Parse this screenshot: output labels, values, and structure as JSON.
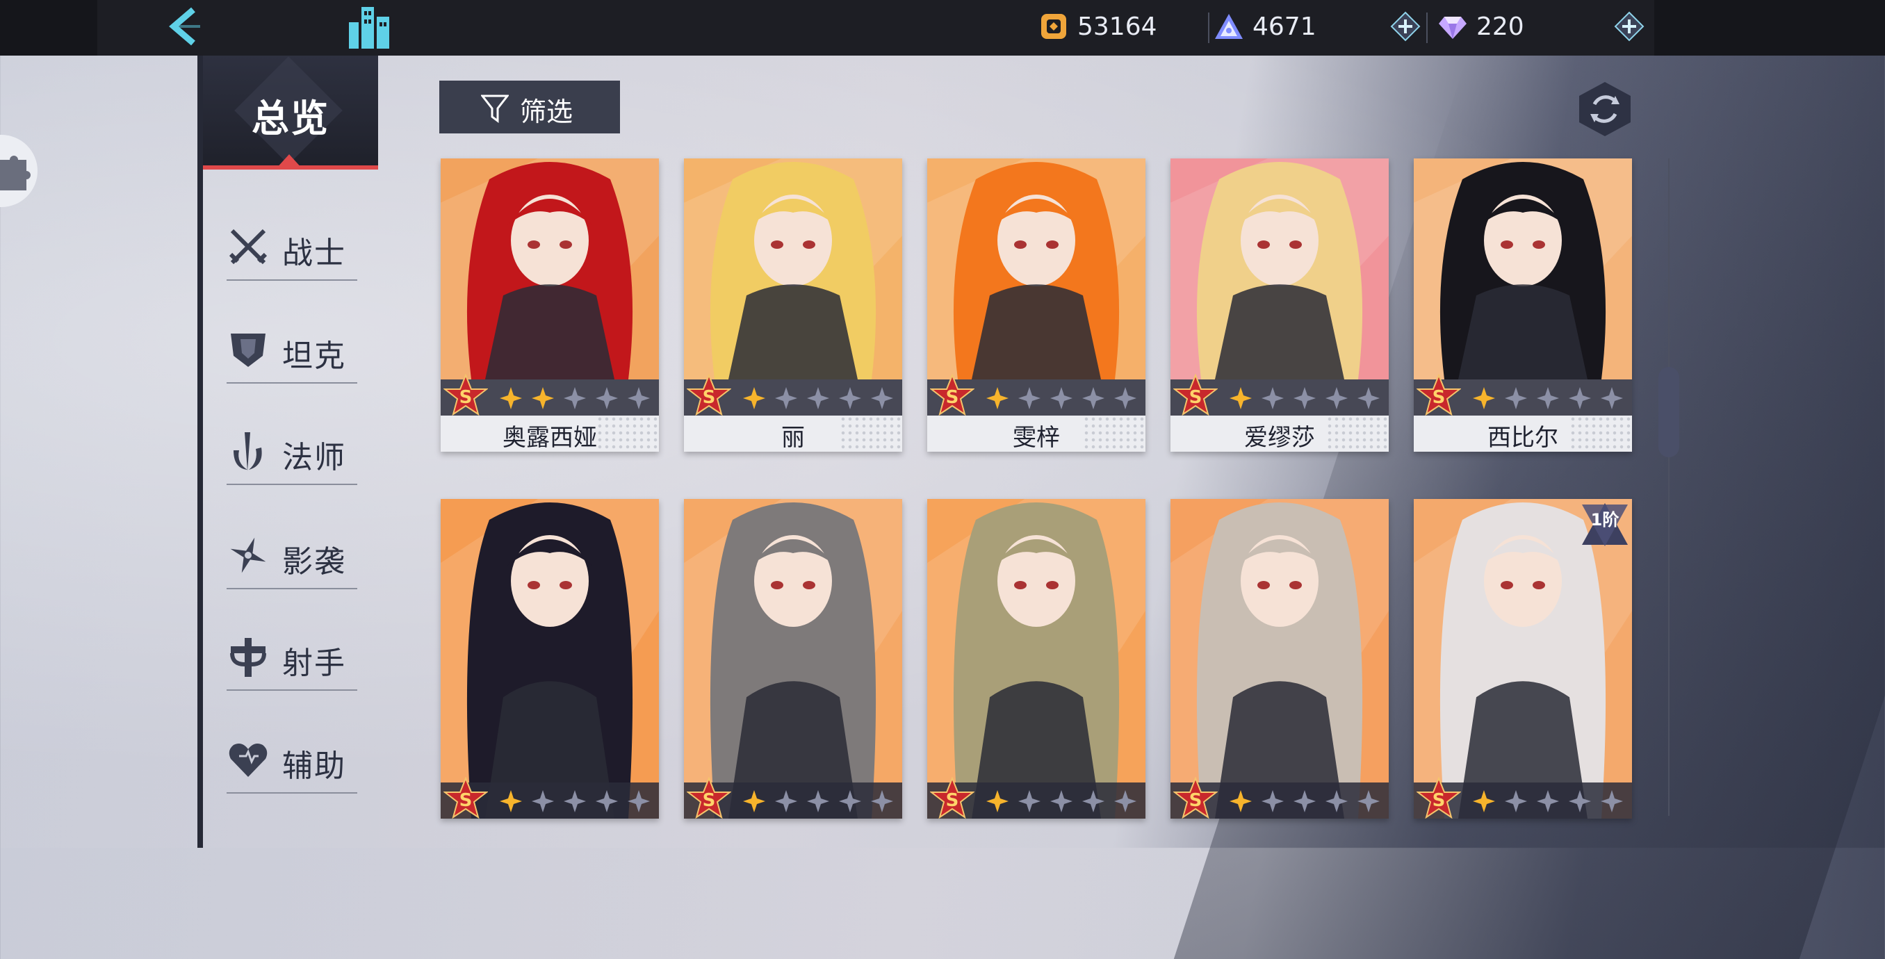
{
  "topbar": {
    "back_icon": "back-chevron-icon",
    "city_icon": "city-building-icon",
    "resources": [
      {
        "icon": "gold-coin-icon",
        "value": "53164",
        "color": "#f0a53a"
      },
      {
        "icon": "stamina-triangle-icon",
        "value": "4671",
        "color": "#7f8cff"
      },
      {
        "icon": "diamond-gem-icon",
        "value": "220",
        "color": "#c6a8ff"
      }
    ]
  },
  "sidebar": {
    "overview_label": "总览",
    "categories": [
      {
        "label": "战士",
        "icon": "crossed-swords-icon"
      },
      {
        "label": "坦克",
        "icon": "shield-icon"
      },
      {
        "label": "法师",
        "icon": "mage-staff-icon"
      },
      {
        "label": "影袭",
        "icon": "shuriken-icon"
      },
      {
        "label": "射手",
        "icon": "crosshair-icon"
      },
      {
        "label": "辅助",
        "icon": "heart-icon"
      }
    ]
  },
  "filter": {
    "label": "筛选",
    "icon": "funnel-icon"
  },
  "sync_icon": "refresh-cycle-icon",
  "characters": [
    {
      "name": "奥露西娅",
      "rank": "S",
      "stars": 2,
      "hair": "#c2171b",
      "bg": "#f2a35e"
    },
    {
      "name": "丽",
      "rank": "S",
      "stars": 1,
      "hair": "#f1cc63",
      "bg": "#f4b36a"
    },
    {
      "name": "雯梓",
      "rank": "S",
      "stars": 1,
      "hair": "#f3771d",
      "bg": "#f5b06a"
    },
    {
      "name": "爱缪莎",
      "rank": "S",
      "stars": 1,
      "hair": "#f0d08a",
      "bg": "#f1949a"
    },
    {
      "name": "西比尔",
      "rank": "S",
      "stars": 1,
      "hair": "#17161c",
      "bg": "#f4b47a"
    },
    {
      "name": "",
      "rank": "S",
      "stars": 1,
      "hair": "#1e1b2a",
      "bg": "#f59c52"
    },
    {
      "name": "",
      "rank": "S",
      "stars": 1,
      "hair": "#7e7a7a",
      "bg": "#f5a866"
    },
    {
      "name": "",
      "rank": "S",
      "stars": 1,
      "hair": "#a99f78",
      "bg": "#f6a35a"
    },
    {
      "name": "",
      "rank": "S",
      "stars": 1,
      "hair": "#c9beb3",
      "bg": "#f5a060"
    },
    {
      "name": "",
      "rank": "S",
      "stars": 1,
      "hair": "#e5e0e0",
      "bg": "#f4a96c",
      "tier_badge": "1阶"
    }
  ]
}
